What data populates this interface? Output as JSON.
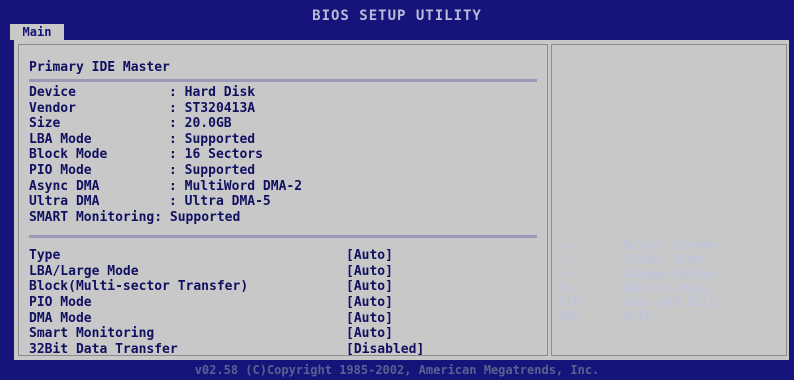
{
  "header": {
    "title": "BIOS SETUP UTILITY",
    "tab": "Main"
  },
  "section_title": "Primary IDE Master",
  "info": [
    {
      "key": "Device",
      "sep": ": ",
      "value": "Hard Disk"
    },
    {
      "key": "Vendor",
      "sep": ": ",
      "value": "ST320413A"
    },
    {
      "key": "Size",
      "sep": ": ",
      "value": "20.0GB"
    },
    {
      "key": "LBA Mode",
      "sep": ": ",
      "value": "Supported"
    },
    {
      "key": "Block Mode",
      "sep": ": ",
      "value": "16 Sectors"
    },
    {
      "key": "PIO Mode",
      "sep": ": ",
      "value": "Supported"
    },
    {
      "key": "Async DMA",
      "sep": ": ",
      "value": "MultiWord DMA-2"
    },
    {
      "key": "Ultra DMA",
      "sep": ": ",
      "value": "Ultra DMA-5"
    },
    {
      "key": "SMART Monitoring",
      "sep": ": ",
      "value": "Supported"
    }
  ],
  "settings": [
    {
      "label": "Type",
      "value": "[Auto]"
    },
    {
      "label": "LBA/Large Mode",
      "value": "[Auto]"
    },
    {
      "label": "Block(Multi-sector Transfer)",
      "value": "[Auto]"
    },
    {
      "label": "PIO Mode",
      "value": "[Auto]"
    },
    {
      "label": "DMA Mode",
      "value": "[Auto]"
    },
    {
      "label": "Smart Monitoring",
      "value": "[Auto]"
    },
    {
      "label": "32Bit Data Transfer",
      "value": "[Disabled]"
    }
  ],
  "help": [
    {
      "key": "←→",
      "desc": "Select Screen"
    },
    {
      "key": "↑↓",
      "desc": "Select Item"
    },
    {
      "key": "+-",
      "desc": "Change Option"
    },
    {
      "key": "F1",
      "desc": "General Help"
    },
    {
      "key": "F10",
      "desc": "Save and Exit"
    },
    {
      "key": "ESC",
      "desc": "Exit"
    }
  ],
  "footer": "v02.58 (C)Copyright 1985-2002, American Megatrends, Inc.",
  "colors": {
    "background": "#14147a",
    "panel": "#c8c8c8",
    "text_dark": "#101060",
    "help_text": "#c0c4dc"
  }
}
